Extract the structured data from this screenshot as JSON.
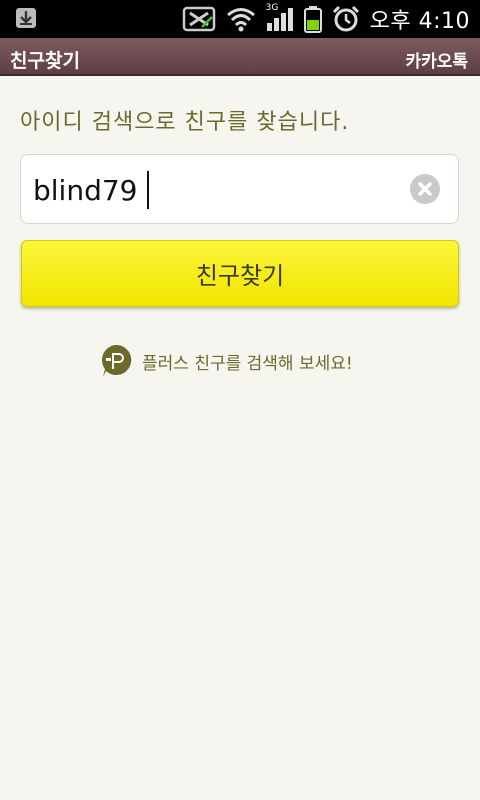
{
  "status_bar": {
    "time": "오후 4:10",
    "network_label": "3G",
    "icons": [
      "download-icon",
      "no-sim-icon",
      "wifi-icon",
      "signal-icon",
      "battery-icon",
      "alarm-icon"
    ]
  },
  "title_bar": {
    "title": "친구찾기",
    "app_name": "카카오톡"
  },
  "main": {
    "instruction": "아이디 검색으로 친구를 찾습니다.",
    "search_input": {
      "value": "blind79",
      "placeholder": ""
    },
    "find_button_label": "친구찾기",
    "plus_friend_text": "플러스 친구를 검색해 보세요!"
  },
  "colors": {
    "title_bar": "#6f4d51",
    "button_yellow": "#f7ef12",
    "text_olive": "#6b6a2a",
    "background": "#f6f5ef"
  }
}
